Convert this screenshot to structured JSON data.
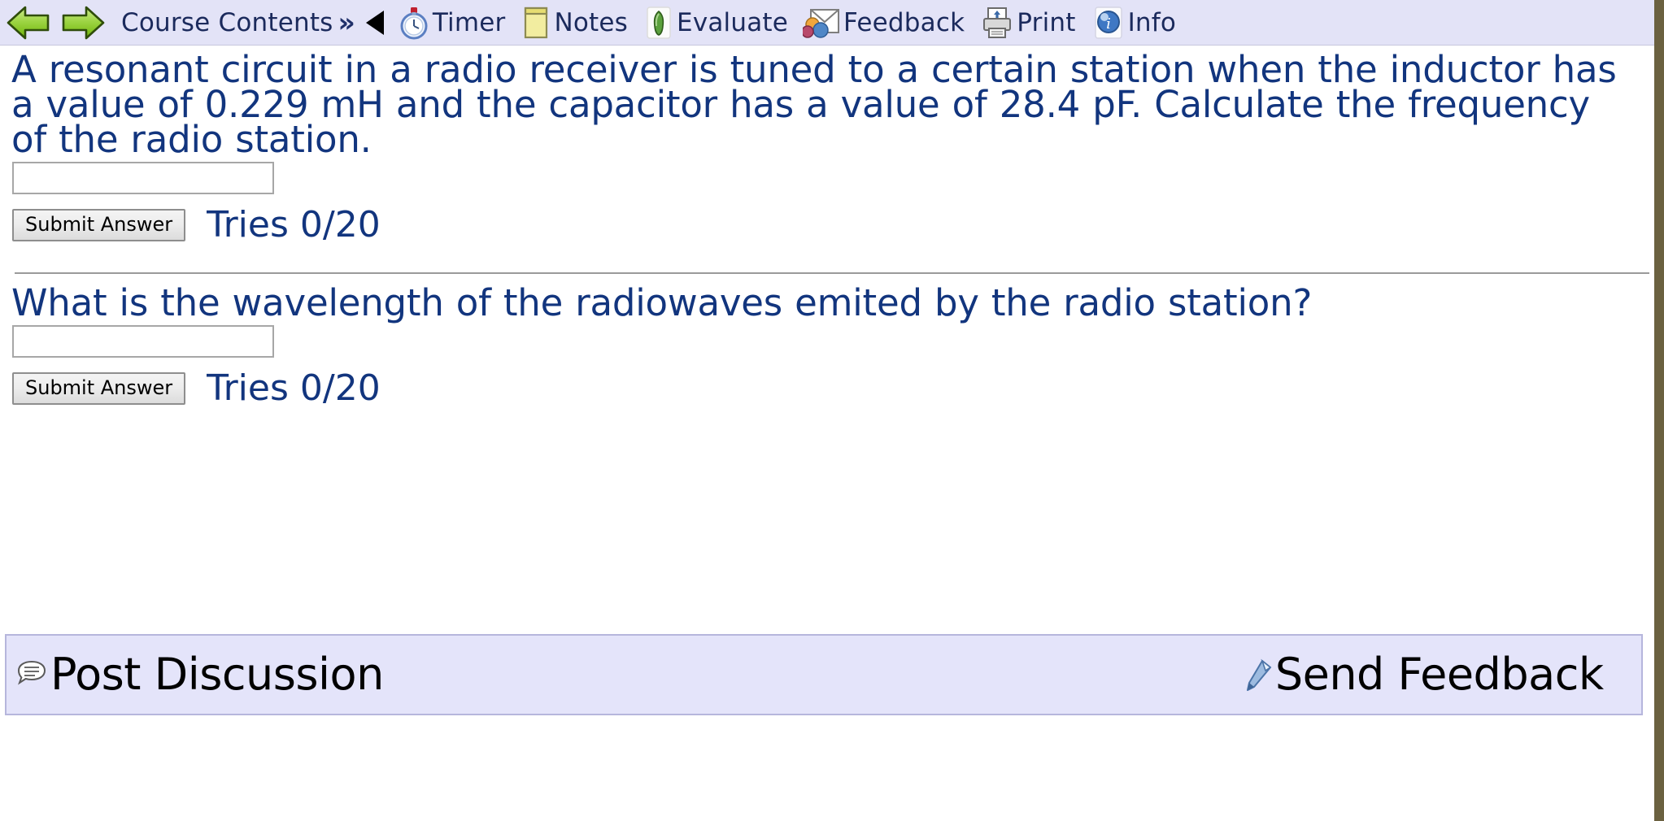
{
  "toolbar": {
    "back_icon": "left-arrow-icon",
    "forward_icon": "right-arrow-icon",
    "course_contents_label": "Course Contents",
    "chevron": "»",
    "collapse_icon": "left-triangle-icon",
    "items": [
      {
        "icon": "timer-icon",
        "label": "Timer"
      },
      {
        "icon": "notes-icon",
        "label": "Notes"
      },
      {
        "icon": "evaluate-icon",
        "label": "Evaluate"
      },
      {
        "icon": "feedback-icon",
        "label": "Feedback"
      },
      {
        "icon": "print-icon",
        "label": "Print"
      },
      {
        "icon": "info-icon",
        "label": "Info"
      }
    ]
  },
  "problems": [
    {
      "text": "A resonant circuit in a radio receiver is tuned to a certain station when the inductor has a value of 0.229 mH and the capacitor has a value of 28.4 pF. Calculate the frequency of the radio station.",
      "answer_value": "",
      "submit_label": "Submit Answer",
      "tries_label": "Tries 0/20"
    },
    {
      "text": "What is the wavelength of the radiowaves emited by the radio station?",
      "answer_value": "",
      "submit_label": "Submit Answer",
      "tries_label": "Tries 0/20"
    }
  ],
  "footer": {
    "post_discussion_icon": "speech-bubble-icon",
    "post_discussion_label": "Post Discussion",
    "send_feedback_icon": "send-feedback-icon",
    "send_feedback_label": "Send Feedback"
  },
  "colors": {
    "toolbar_bg": "#e3e3f7",
    "question_text": "#12357e",
    "footer_bg": "#e4e4fa",
    "page_border": "#6b6140"
  }
}
